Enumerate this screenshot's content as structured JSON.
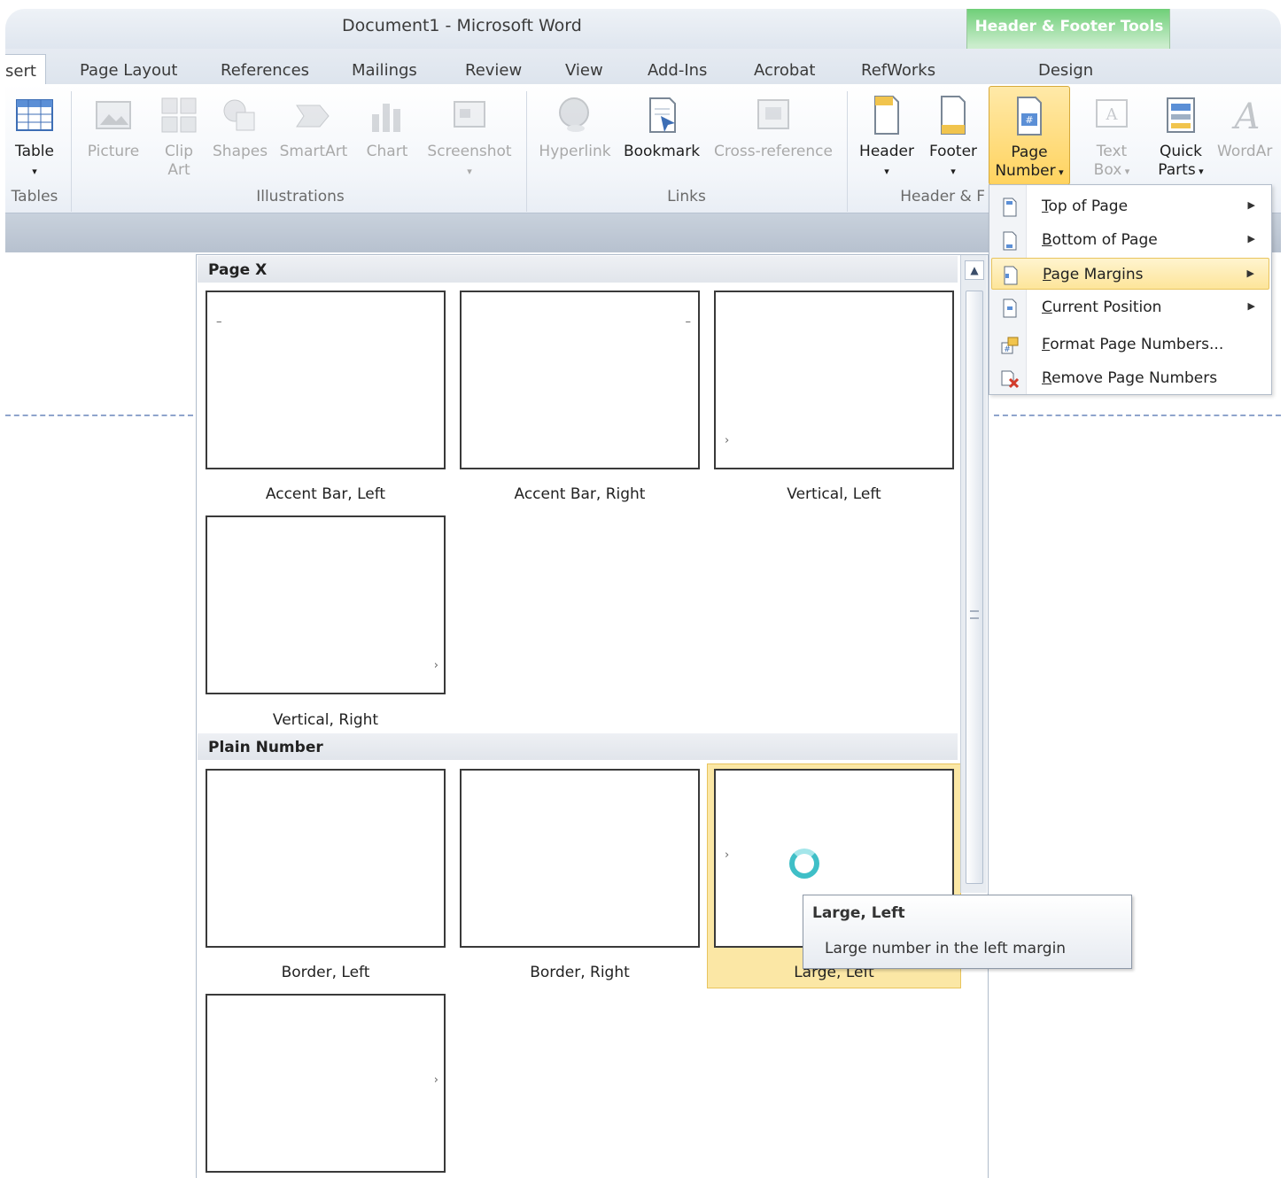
{
  "window": {
    "title": "Document1  -  Microsoft Word",
    "contextual_tab_group": "Header & Footer Tools"
  },
  "tabs": [
    "sert",
    "Page Layout",
    "References",
    "Mailings",
    "Review",
    "View",
    "Add-Ins",
    "Acrobat",
    "RefWorks",
    "Design"
  ],
  "ribbon": {
    "tables": {
      "table": "Table",
      "group": "Tables"
    },
    "illustrations": {
      "picture": "Picture",
      "clip_art": "Clip Art",
      "shapes": "Shapes",
      "smartart": "SmartArt",
      "chart": "Chart",
      "screenshot": "Screenshot",
      "group": "Illustrations"
    },
    "links": {
      "hyperlink": "Hyperlink",
      "bookmark": "Bookmark",
      "cross_reference": "Cross-reference",
      "group": "Links"
    },
    "header_footer": {
      "header": "Header",
      "footer": "Footer",
      "page_number_line1": "Page",
      "page_number_line2": "Number",
      "group": "Header & F"
    },
    "text": {
      "text_box_line1": "Text",
      "text_box_line2": "Box",
      "quick_parts_line1": "Quick",
      "quick_parts_line2": "Parts",
      "wordart": "WordAr"
    }
  },
  "page_number_menu": [
    {
      "label": "Top of Page",
      "underline": "T",
      "rest": "op of Page",
      "submenu": true
    },
    {
      "label": "Bottom of Page",
      "underline": "B",
      "rest": "ottom of Page",
      "submenu": true
    },
    {
      "label": "Page Margins",
      "underline": "P",
      "rest": "age Margins",
      "submenu": true
    },
    {
      "label": "Current Position",
      "underline": "C",
      "rest": "urrent Position",
      "submenu": true
    },
    {
      "label": "Format Page Numbers...",
      "underline": "F",
      "rest": "ormat Page Numbers...",
      "submenu": false
    },
    {
      "label": "Remove Page Numbers",
      "underline": "R",
      "rest": "emove Page Numbers",
      "submenu": false
    }
  ],
  "gallery": {
    "section_page_x": "Page X",
    "section_plain_number": "Plain Number",
    "items": [
      {
        "label": "Accent Bar, Left"
      },
      {
        "label": "Accent Bar, Right"
      },
      {
        "label": "Vertical, Left"
      },
      {
        "label": "Vertical, Right"
      },
      {
        "label": "Border, Left"
      },
      {
        "label": "Border, Right"
      },
      {
        "label": "Large, Left"
      }
    ]
  },
  "tooltip": {
    "title": "Large, Left",
    "body": "Large number in the left margin"
  },
  "colors": {
    "contextual_green": "#6fcf78",
    "highlight_gold": "#ffd35f",
    "busy_cursor": "#3fbfc7"
  }
}
